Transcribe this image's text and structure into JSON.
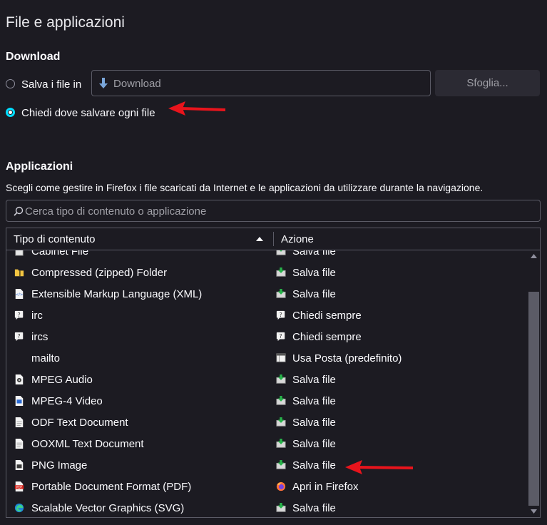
{
  "page_title": "File e applicazioni",
  "download": {
    "heading": "Download",
    "save_label": "Salva i file in",
    "save_path_placeholder": "Download",
    "browse_label": "Sfoglia...",
    "ask_label": "Chiedi dove salvare ogni file"
  },
  "apps": {
    "heading": "Applicazioni",
    "description": "Scegli come gestire in Firefox i file scaricati da Internet e le applicazioni da utilizzare durante la navigazione.",
    "search_placeholder": "Cerca tipo di contenuto o applicazione",
    "col_type": "Tipo di contenuto",
    "col_action": "Azione",
    "rows": [
      {
        "type": "Cabinet File",
        "action": "Salva file",
        "type_icon": "cabinet-icon",
        "action_icon": "save-file-icon"
      },
      {
        "type": "Compressed (zipped) Folder",
        "action": "Salva file",
        "type_icon": "zip-folder-icon",
        "action_icon": "save-file-icon"
      },
      {
        "type": "Extensible Markup Language (XML)",
        "action": "Salva file",
        "type_icon": "xml-file-icon",
        "action_icon": "save-file-icon"
      },
      {
        "type": "irc",
        "action": "Chiedi sempre",
        "type_icon": "chat-icon",
        "action_icon": "ask-icon"
      },
      {
        "type": "ircs",
        "action": "Chiedi sempre",
        "type_icon": "chat-icon",
        "action_icon": "ask-icon"
      },
      {
        "type": "mailto",
        "action": "Usa Posta (predefinito)",
        "type_icon": "",
        "action_icon": "mail-app-icon"
      },
      {
        "type": "MPEG Audio",
        "action": "Salva file",
        "type_icon": "audio-file-icon",
        "action_icon": "save-file-icon"
      },
      {
        "type": "MPEG-4 Video",
        "action": "Salva file",
        "type_icon": "video-file-icon",
        "action_icon": "save-file-icon"
      },
      {
        "type": "ODF Text Document",
        "action": "Salva file",
        "type_icon": "document-icon",
        "action_icon": "save-file-icon"
      },
      {
        "type": "OOXML Text Document",
        "action": "Salva file",
        "type_icon": "document-icon",
        "action_icon": "save-file-icon"
      },
      {
        "type": "PNG Image",
        "action": "Salva file",
        "type_icon": "image-file-icon",
        "action_icon": "save-file-icon"
      },
      {
        "type": "Portable Document Format (PDF)",
        "action": "Apri in Firefox",
        "type_icon": "pdf-icon",
        "action_icon": "firefox-icon"
      },
      {
        "type": "Scalable Vector Graphics (SVG)",
        "action": "Salva file",
        "type_icon": "edge-icon",
        "action_icon": "save-file-icon"
      }
    ]
  },
  "colors": {
    "background": "#1c1b22",
    "accent": "#00ddff",
    "annotation_arrow": "#e8141c"
  }
}
